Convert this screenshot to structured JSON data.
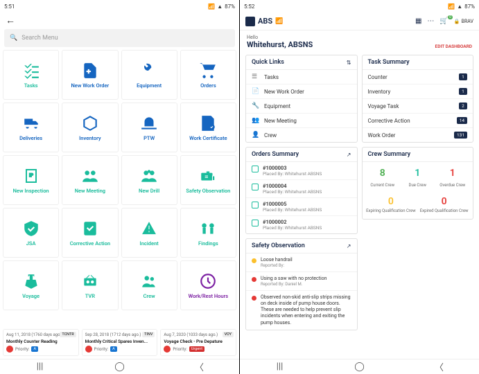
{
  "status": {
    "time": "5:51",
    "battery": "87%"
  },
  "status2": {
    "time": "5:52",
    "battery": "87%"
  },
  "left": {
    "search_placeholder": "Search Menu",
    "tiles": [
      {
        "label": "Tasks",
        "color": "#1abc9c"
      },
      {
        "label": "New Work Order",
        "color": "#1565c0"
      },
      {
        "label": "Equipment",
        "color": "#1565c0"
      },
      {
        "label": "Orders",
        "color": "#1565c0"
      },
      {
        "label": "Deliveries",
        "color": "#1565c0"
      },
      {
        "label": "Inventory",
        "color": "#1565c0"
      },
      {
        "label": "PTW",
        "color": "#1565c0"
      },
      {
        "label": "Work Certificate",
        "color": "#1565c0"
      },
      {
        "label": "New Inspection",
        "color": "#1abc9c"
      },
      {
        "label": "New Meeting",
        "color": "#1abc9c"
      },
      {
        "label": "New Drill",
        "color": "#1abc9c"
      },
      {
        "label": "Safety Observation",
        "color": "#1abc9c"
      },
      {
        "label": "JSA",
        "color": "#1abc9c"
      },
      {
        "label": "Corrective Action",
        "color": "#1abc9c"
      },
      {
        "label": "Incident",
        "color": "#1abc9c"
      },
      {
        "label": "Findings",
        "color": "#1abc9c"
      },
      {
        "label": "Voyage",
        "color": "#1abc9c"
      },
      {
        "label": "TVR",
        "color": "#1abc9c"
      },
      {
        "label": "Crew",
        "color": "#1abc9c"
      },
      {
        "label": "Work/Rest Hours",
        "color": "#7b1fa2"
      }
    ],
    "cards": [
      {
        "date": "Aug 11, 2018 (1760 days ago.)",
        "tag": "TCNTR",
        "title": "Monthly Counter Reading",
        "priority": "A",
        "pill": "pill-a",
        "priority_label": "Priority:",
        "next_hint": "VO"
      },
      {
        "date": "Sep 28, 2018 (1712 days ago.)",
        "tag": "TINV",
        "title": "Monthly Critical Spares Inven...",
        "priority": "A",
        "pill": "pill-a",
        "priority_label": "Priority:"
      },
      {
        "date": "Aug 7, 2020 (1033 days ago.)",
        "tag": "VOY",
        "title": "Voyage Check - Pre Depature",
        "priority": "Urgent",
        "pill": "pill-urgent",
        "priority_label": "Priority:"
      }
    ]
  },
  "right": {
    "brand": "ABS",
    "cart_count": "0",
    "user": "BRAV",
    "hello": "Hello",
    "name": "Whitehurst, ABSNS",
    "edit": "EDIT DASHBOARD",
    "quicklinks": {
      "title": "Quick Links",
      "items": [
        {
          "label": "Tasks"
        },
        {
          "label": "New Work Order"
        },
        {
          "label": "Equipment"
        },
        {
          "label": "New Meeting"
        },
        {
          "label": "Crew"
        }
      ]
    },
    "tasksummary": {
      "title": "Task Summary",
      "items": [
        {
          "label": "Counter",
          "count": "1"
        },
        {
          "label": "Inventory",
          "count": "1"
        },
        {
          "label": "Voyage Task",
          "count": "2"
        },
        {
          "label": "Corrective Action",
          "count": "14"
        },
        {
          "label": "Work Order",
          "count": "131"
        }
      ]
    },
    "orders": {
      "title": "Orders Summary",
      "items": [
        {
          "num": "#1000003",
          "sub": "Placed By: Whitehurst ABSNS"
        },
        {
          "num": "#1000004",
          "sub": "Placed By: Whitehurst ABSNS"
        },
        {
          "num": "#1000005",
          "sub": "Placed By: Whitehurst ABSNS"
        },
        {
          "num": "#1000002",
          "sub": "Placed By: Whitehurst ABSNS"
        }
      ]
    },
    "crew": {
      "title": "Crew Summary",
      "a": [
        {
          "num": "8",
          "lbl": "Current Crew",
          "cls": "c-green"
        },
        {
          "num": "1",
          "lbl": "Due Crew",
          "cls": "c-teal"
        },
        {
          "num": "1",
          "lbl": "Overdue Crew",
          "cls": "c-red"
        }
      ],
      "b": [
        {
          "num": "0",
          "lbl": "Expiring Qualification Crew",
          "cls": "c-amber"
        },
        {
          "num": "0",
          "lbl": "Expired Qualification Crew",
          "cls": "c-red"
        }
      ]
    },
    "safety": {
      "title": "Safety Observation",
      "items": [
        {
          "color": "#fbc02d",
          "t": "Loose handrail",
          "s": "Reported By:"
        },
        {
          "color": "#e53935",
          "t": "Using a saw with no protection",
          "s": "Reported By: Daniel M."
        },
        {
          "color": "#e53935",
          "t": "Observed non-skid anti-slip strips missing on deck inside of pump house doors. These are needed to help prevent slip incidents when entering and exiting the pump houses.",
          "s": ""
        }
      ]
    }
  }
}
